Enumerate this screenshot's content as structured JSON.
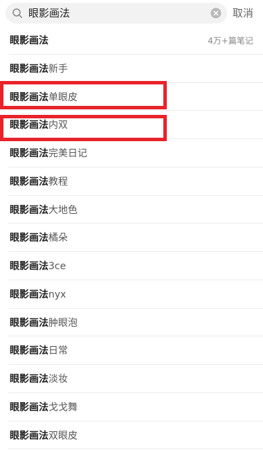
{
  "search": {
    "query": "眼影画法",
    "cancel_label": "取消"
  },
  "suggestions": [
    {
      "keyword": "眼影画法",
      "suffix": "",
      "count": "4万+篇笔记"
    },
    {
      "keyword": "眼影画法",
      "suffix": "新手"
    },
    {
      "keyword": "眼影画法",
      "suffix": "单眼皮"
    },
    {
      "keyword": "眼影画法",
      "suffix": "内双"
    },
    {
      "keyword": "眼影画法",
      "suffix": "完美日记"
    },
    {
      "keyword": "眼影画法",
      "suffix": "教程"
    },
    {
      "keyword": "眼影画法",
      "suffix": "大地色"
    },
    {
      "keyword": "眼影画法",
      "suffix": "橘朵"
    },
    {
      "keyword": "眼影画法",
      "suffix": "3ce"
    },
    {
      "keyword": "眼影画法",
      "suffix": "nyx"
    },
    {
      "keyword": "眼影画法",
      "suffix": "肿眼泡"
    },
    {
      "keyword": "眼影画法",
      "suffix": "日常"
    },
    {
      "keyword": "眼影画法",
      "suffix": "淡妆"
    },
    {
      "keyword": "眼影画法",
      "suffix": "戈戈舞"
    },
    {
      "keyword": "眼影画法",
      "suffix": "双眼皮"
    }
  ],
  "colors": {
    "highlight": "#e8232a",
    "search_bg": "#f2f2f2"
  }
}
